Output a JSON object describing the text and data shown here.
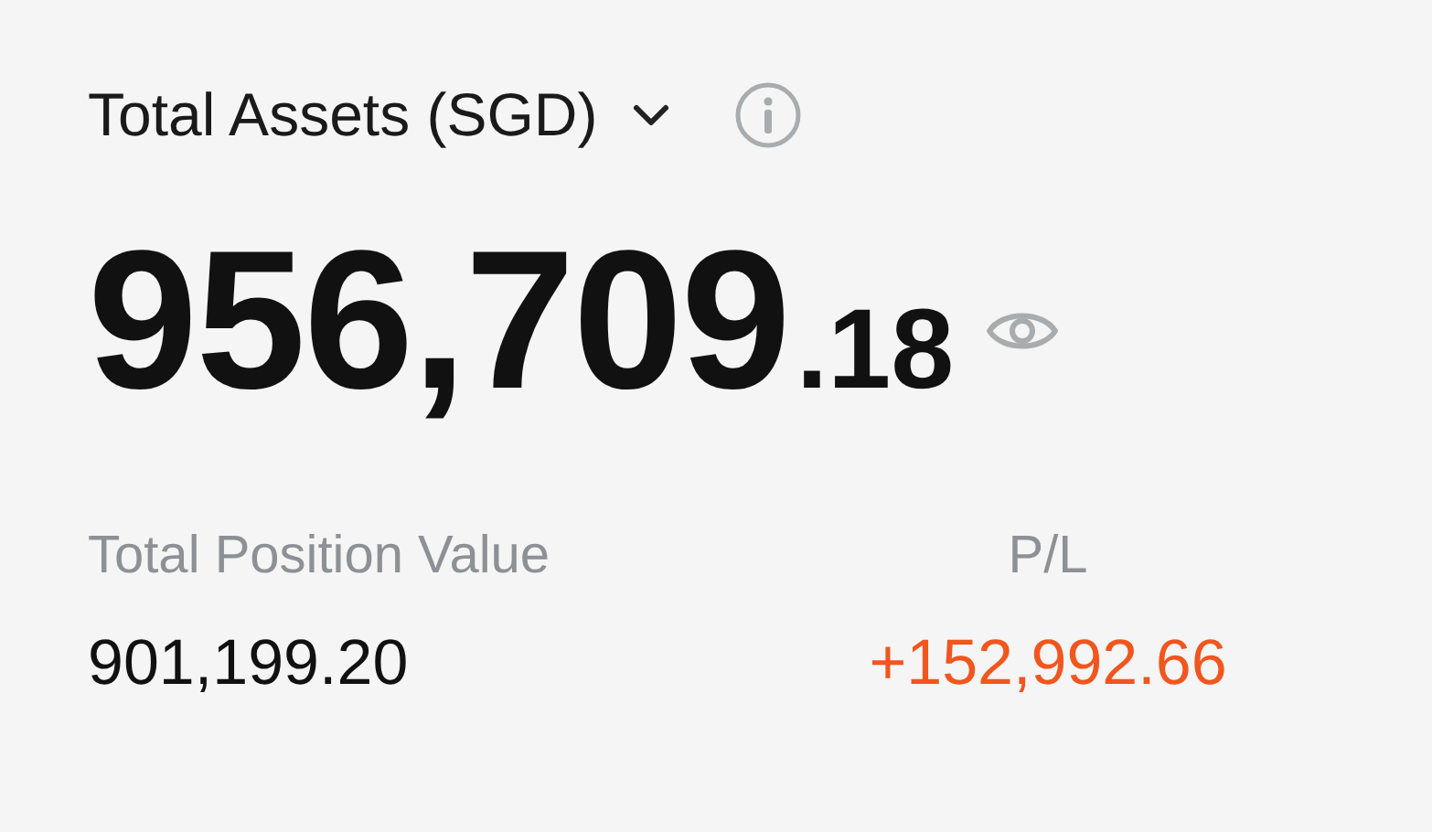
{
  "header": {
    "title": "Total Assets (SGD)"
  },
  "total": {
    "integer": "956,709",
    "decimal": ".18"
  },
  "metrics": [
    {
      "label": "Total Position Value",
      "value": "901,199.20",
      "kind": "neutral"
    },
    {
      "label": "P/L",
      "value": "+152,992.66",
      "kind": "gain"
    }
  ]
}
